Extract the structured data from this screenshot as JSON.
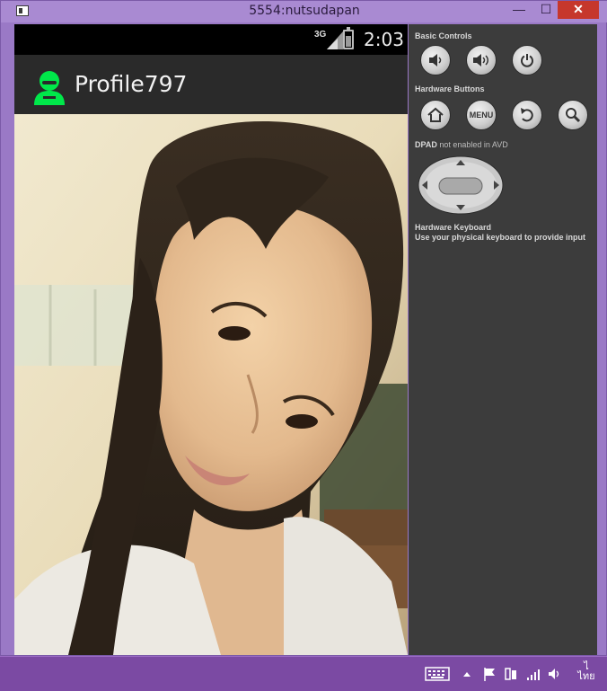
{
  "window": {
    "title": "5554:nutsudapan",
    "minimize_glyph": "—",
    "maximize_glyph": "☐",
    "close_glyph": "✕"
  },
  "status_bar": {
    "network": "3G",
    "time": "2:03"
  },
  "action_bar": {
    "icon": "profile-person-icon",
    "title": "Profile797",
    "accent_color": "#00e84a"
  },
  "content": {
    "image": "profile-photo"
  },
  "panel": {
    "basic_controls_label": "Basic Controls",
    "basic_controls": [
      "volume-down-icon",
      "volume-up-icon",
      "power-icon"
    ],
    "hardware_buttons_label": "Hardware Buttons",
    "hardware_buttons": [
      {
        "icon": "home-icon",
        "label": ""
      },
      {
        "icon": "menu-button",
        "label": "MENU"
      },
      {
        "icon": "back-icon",
        "label": ""
      },
      {
        "icon": "search-icon",
        "label": ""
      }
    ],
    "dpad_label": "DPAD",
    "dpad_status": "not enabled in AVD",
    "keyboard_title": "Hardware Keyboard",
    "keyboard_hint": "Use your physical keyboard to provide input"
  },
  "taskbar": {
    "tray_icons": [
      "keyboard-icon",
      "chevron-up-icon",
      "flag-icon",
      "power-plug-icon",
      "signal-icon",
      "speaker-icon"
    ],
    "ime_top": "ไ",
    "ime_bottom": "ไทย",
    "ime_label": "ไทย"
  }
}
